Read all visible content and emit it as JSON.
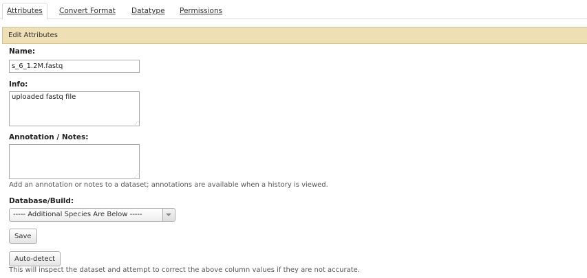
{
  "tabs": [
    {
      "label": "Attributes",
      "active": true
    },
    {
      "label": "Convert Format",
      "active": false
    },
    {
      "label": "Datatype",
      "active": false
    },
    {
      "label": "Permissions",
      "active": false
    }
  ],
  "panel": {
    "title": "Edit Attributes"
  },
  "form": {
    "name": {
      "label": "Name:",
      "value": "s_6_1.2M.fastq"
    },
    "info": {
      "label": "Info:",
      "value": "uploaded fastq file"
    },
    "annotation": {
      "label": "Annotation / Notes:",
      "value": "",
      "help": "Add an annotation or notes to a dataset; annotations are available when a history is viewed."
    },
    "database": {
      "label": "Database/Build:",
      "selected": "----- Additional Species Are Below -----"
    },
    "save_label": "Save",
    "autodetect_label": "Auto-detect",
    "autodetect_help": "This will inspect the dataset and attempt to correct the above column values if they are not accurate."
  },
  "colors": {
    "panel_header_bg": "#efdfb5",
    "panel_header_border": "#d8c28e"
  }
}
